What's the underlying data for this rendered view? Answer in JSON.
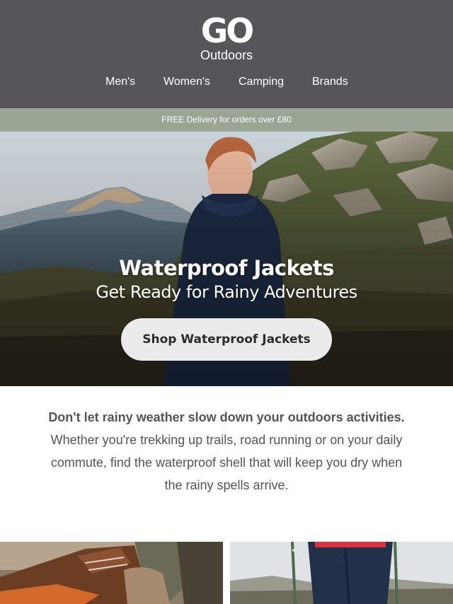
{
  "header": {
    "logo": {
      "mark": "GO",
      "sub": "Outdoors"
    },
    "nav": [
      {
        "label": "Men's"
      },
      {
        "label": "Women's"
      },
      {
        "label": "Camping"
      },
      {
        "label": "Brands"
      }
    ],
    "background_color": "#57555a"
  },
  "promo_bar": {
    "text": "FREE Delivery for orders over £80",
    "background_color": "#9aa595"
  },
  "hero": {
    "title": "Waterproof Jackets",
    "subtitle": "Get Ready for Rainy Adventures",
    "cta_label": "Shop Waterproof Jackets",
    "image": "woman-laughing-in-rain-jacket-mountains"
  },
  "intro": {
    "heading": "Don't let rainy weather slow down your outdoors activities.",
    "body": "Whether you're trekking up trails, road running or on your daily commute, find the waterproof shell that will keep you dry when the rainy spells arrive."
  },
  "tiles": [
    {
      "image": "hiking-boots-closeup"
    },
    {
      "image": "hiker-legs-with-trekking-poles"
    }
  ]
}
